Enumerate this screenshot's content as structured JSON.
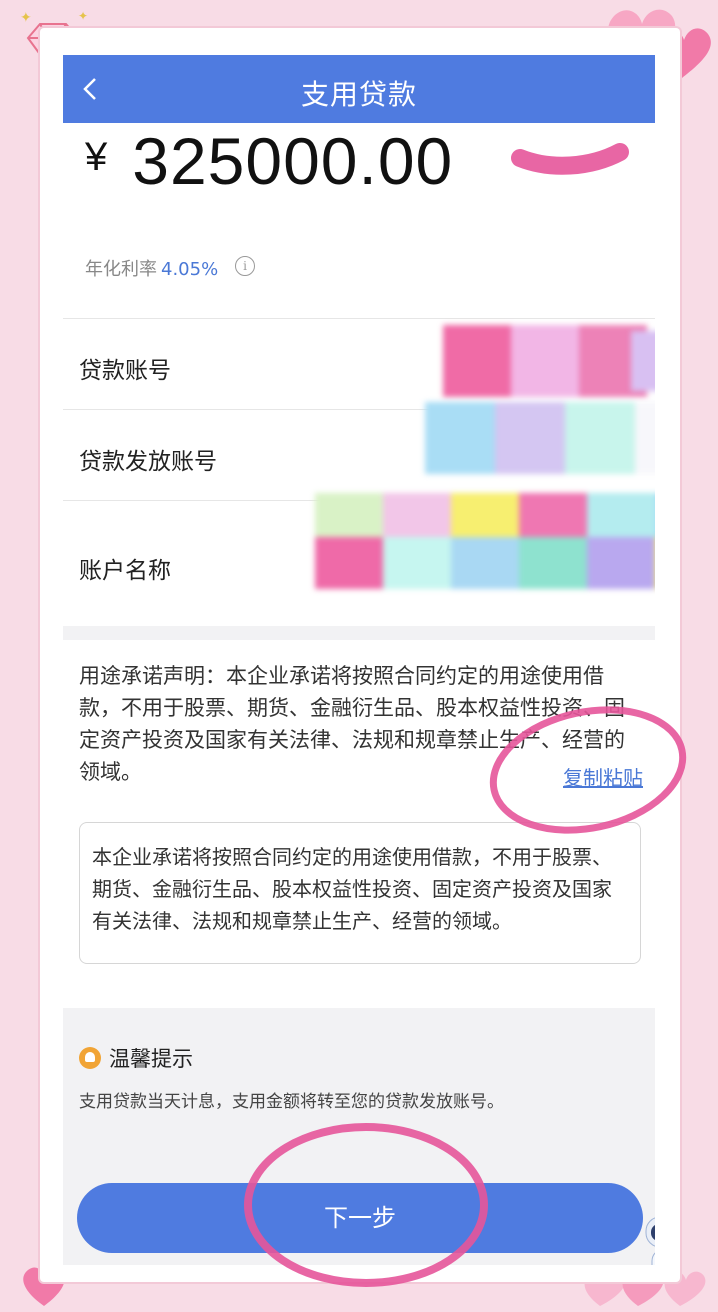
{
  "header": {
    "title": "支用贷款",
    "back_icon": "chevron-left-icon"
  },
  "amount": {
    "currency": "¥",
    "value": "325000.00"
  },
  "rate": {
    "label": "年化利率",
    "value": "4.05%"
  },
  "rows": [
    {
      "label": "贷款账号"
    },
    {
      "label": "贷款发放账号"
    },
    {
      "label": "账户名称"
    }
  ],
  "statement": {
    "text": "用途承诺声明：本企业承诺将按照合同约定的用途使用借款，不用于股票、期货、金融衍生品、股本权益性投资、固定资产投资及国家有关法律、法规和规章禁止生产、经营的领域。",
    "copy_label": "复制粘贴",
    "textarea_value": "本企业承诺将按照合同约定的用途使用借款，不用于股票、期货、金融衍生品、股本权益性投资、固定资产投资及国家有关法律、法规和规章禁止生产、经营的领域。"
  },
  "tips": {
    "title": "温馨提示",
    "text": "支用贷款当天计息，支用金额将转至您的贷款发放账号。"
  },
  "buttons": {
    "next_label": "下一步"
  },
  "colors": {
    "primary": "#4f7be0",
    "link": "#4a78d6",
    "frame_bg": "#f8dce6",
    "annotation": "#e6559a"
  }
}
